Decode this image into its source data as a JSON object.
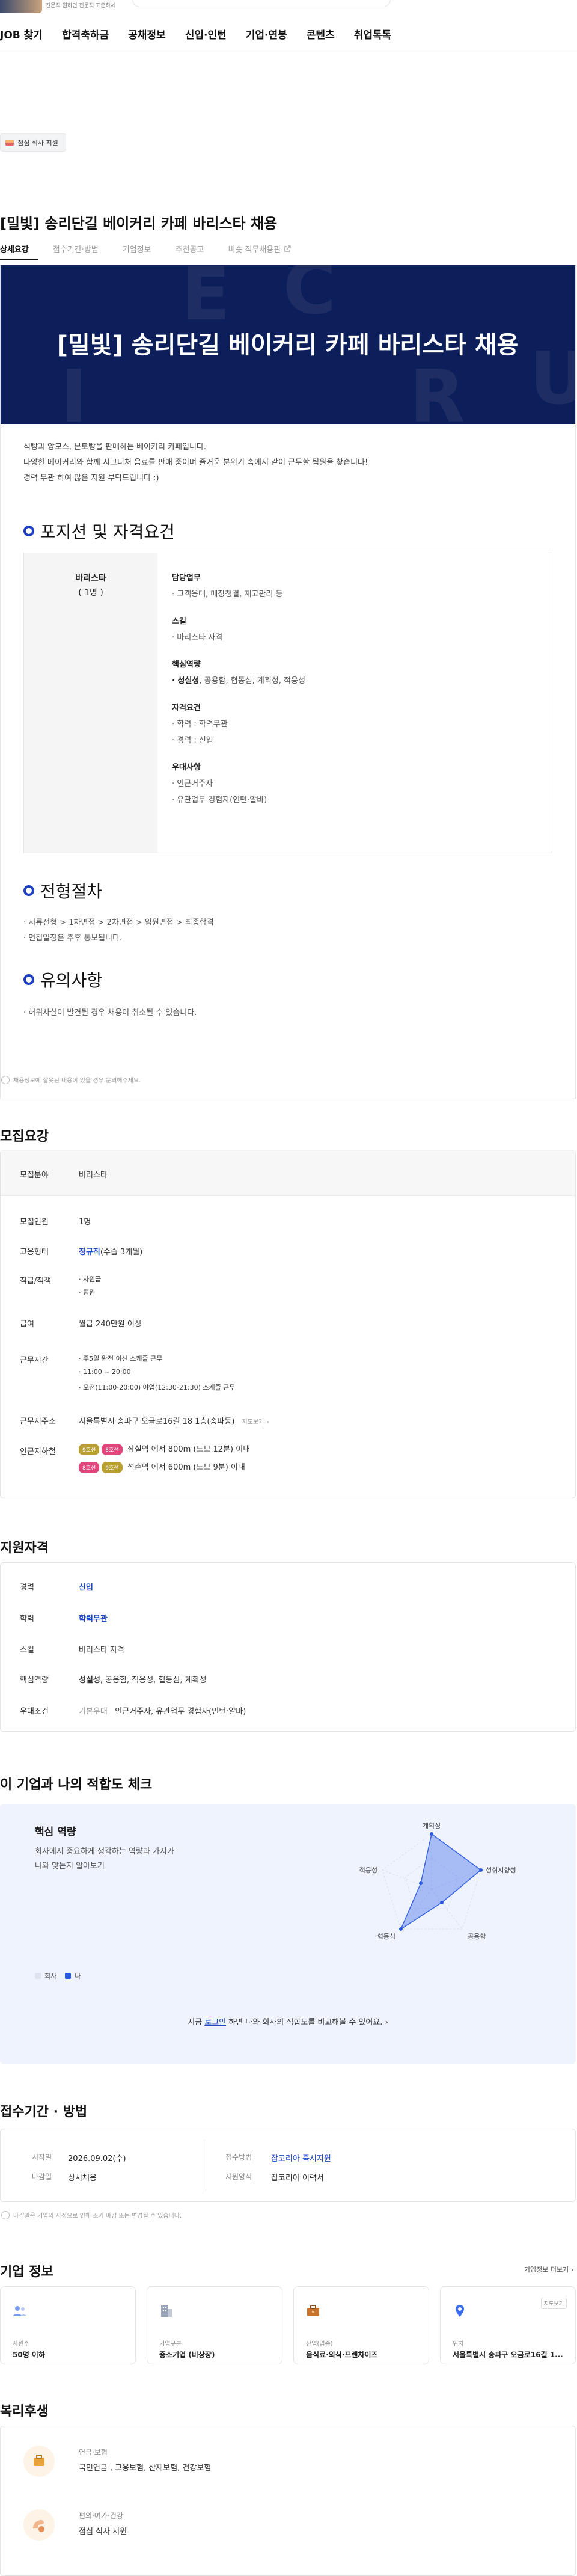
{
  "header": {
    "ad_text": "전문직 원하면 전문직 표준하세",
    "nav": [
      "JOB 찾기",
      "합격축하금",
      "공채정보",
      "신입·인턴",
      "기업·연봉",
      "콘텐츠",
      "취업톡톡"
    ]
  },
  "benefit_chip": "점심 식사 지원",
  "job": {
    "title": "[밀빛] 송리단길 베이커리 카페 바리스타 채용",
    "tabs": [
      "상세요강",
      "접수기간·방법",
      "기업정보",
      "추천공고",
      "비슷 직무채용관"
    ]
  },
  "detail": {
    "banner_title": "[밀빛] 송리단길 베이커리 카페 바리스타 채용",
    "intro": [
      "식빵과 앙모스, 본토빵을 판매하는 베이커리 카페입니다.",
      "다양한 베이커리와 함께 시그니처 음료를 판매 중이며 즐거운 분위기 속에서 같이 근무할 팀원을 찾습니다!",
      "경력 무관 하여 많은 지원 부탁드립니다 :)"
    ],
    "section_position": "포지션 및 자격요건",
    "position_name": "바리스타",
    "position_count": "( 1명 )",
    "groups": [
      {
        "title": "담당업무",
        "items": [
          "· 고객응대, 매장청결, 재고관리 등"
        ]
      },
      {
        "title": "스킬",
        "items": [
          "· 바리스타 자격"
        ]
      },
      {
        "title": "핵심역량",
        "items_bold": "· 성실성",
        "items_rest": ", 공용함, 협동심, 계획성, 적응성"
      },
      {
        "title": "자격요건",
        "items": [
          "· 학력 : 학력무관",
          "· 경력 : 신입"
        ]
      },
      {
        "title": "우대사항",
        "items": [
          "· 인근거주자",
          "· 유관업무 경험자(인턴·알바)"
        ]
      }
    ],
    "section_process": "전형절차",
    "process": [
      "· 서류전형 > 1차면접 > 2차면접 > 임원면접 > 최종합격",
      "· 면접일정은 추후 통보됩니다."
    ],
    "section_notice": "유의사항",
    "notice": [
      "· 허위사실이 발견될 경우 채용이 취소될 수 있습니다."
    ]
  },
  "detail_note": "채용정보에 잘못된 내용이 있을 경우 문의해주세요.",
  "recruit": {
    "heading": "모집요강",
    "rows": [
      {
        "label": "모집분야",
        "value": "바리스타"
      },
      {
        "label": "모집인원",
        "value": "1명"
      },
      {
        "label": "고용형태",
        "value": "정규직",
        "extra": "(수습 3개월)"
      },
      {
        "label": "직급/직책",
        "values": [
          "· 사원급",
          "· 팀원"
        ]
      },
      {
        "label": "급여",
        "value": "월급 240만원 이상"
      },
      {
        "label": "근무시간",
        "values": [
          "· 주5일 완전 이선 스케줄 근무",
          "· 11:00 ~ 20:00",
          "· 오전(11:00-20:00) 야업(12:30-21:30) 스케줄 근무"
        ]
      },
      {
        "label": "근무지주소",
        "value": "서울특별시 송파구 오금로16길 18 1층(송파동)",
        "link": "지도보기"
      },
      {
        "label": "인근지하철",
        "subway": [
          {
            "lines": [
              "9호선",
              "8호선"
            ],
            "text": "잠실역 에서 800m (도보 12분) 이내"
          },
          {
            "lines": [
              "8호선",
              "9호선"
            ],
            "text": "석촌역 에서 600m (도보 9분) 이내"
          }
        ]
      }
    ]
  },
  "qualify": {
    "heading": "지원자격",
    "rows": [
      {
        "label": "경력",
        "value": "신입"
      },
      {
        "label": "학력",
        "value": "학력무관"
      },
      {
        "label": "스킬",
        "value": "바리스타 자격"
      },
      {
        "label": "핵심역량",
        "bold": "성실성",
        "rest": ", 공용함, 적응성, 협동심, 계획성"
      },
      {
        "label": "우대조건",
        "pre": "기본우대",
        "value": "인근거주자, 유관업무 경험자(인턴·알바)"
      }
    ]
  },
  "fit": {
    "heading": "이 기업과 나의 적합도 체크",
    "title": "핵심 역량",
    "desc": [
      "회사에서 중요하게 생각하는 역량과 가지가",
      "나와 맞는지 알아보기"
    ],
    "radar_labels": [
      "계획성",
      "성취지향성",
      "공용함",
      "협동심",
      "적응성"
    ],
    "legend": [
      "회사",
      "나"
    ],
    "cta_pre": "지금 ",
    "cta_link": "로그인",
    "cta_post": " 하면 나와 회사의 적합도를 비교해볼 수 있어요.",
    "colors": {
      "company": "#c7cce0",
      "me": "#4f77ea"
    }
  },
  "apply": {
    "heading": "접수기간 · 방법",
    "start_label": "시작일",
    "start": "2026.09.02(수)",
    "end_label": "마감일",
    "end": "상시채용",
    "method_label": "접수방법",
    "method": "잡코리아 즉시지원",
    "form_label": "지원양식",
    "form": "잡코리아 이력서",
    "note": "마감일은 기업의 사정으로 인해 조기 마감 또는 변경될 수 있습니다."
  },
  "company": {
    "heading": "기업 정보",
    "more": "기업정보 더보기",
    "cards": [
      {
        "label": "사원수",
        "value": "50명 이하",
        "icon": "people-icon"
      },
      {
        "label": "기업구분",
        "value": "중소기업 (비상장)",
        "icon": "building-icon"
      },
      {
        "label": "산업(업종)",
        "value": "음식료·외식·프랜차이즈",
        "icon": "briefcase-icon"
      },
      {
        "label": "위치",
        "value": "서울특별시 송파구 오금로16길 1...",
        "icon": "location-icon",
        "tag": "지도보기"
      }
    ]
  },
  "welfare": {
    "heading": "복리후생",
    "items": [
      {
        "cat": "연금·보험",
        "val": "국민연금 , 고용보험, 산재보험, 건강보험"
      },
      {
        "cat": "편의·여가·건강",
        "val": "점심 식사 지원"
      }
    ]
  }
}
